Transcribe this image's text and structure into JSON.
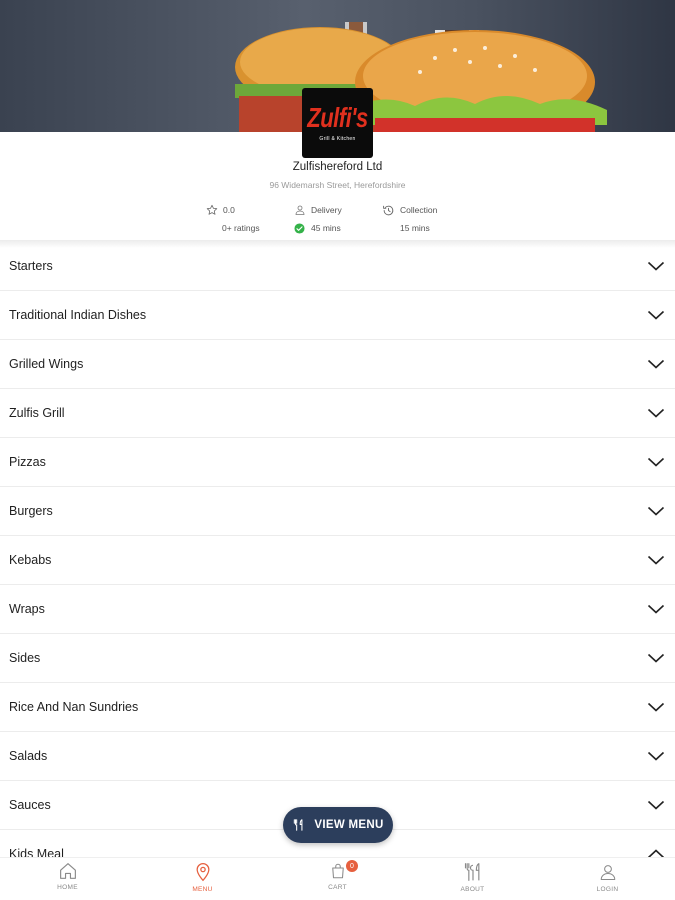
{
  "store": {
    "logo_text": "Zulfi's",
    "logo_subtext": "Grill & Kitchen",
    "name": "Zulfishereford Ltd",
    "address": "96 Widemarsh Street, Herefordshire"
  },
  "stats": {
    "rating_value": "0.0",
    "rating_count": "0+ ratings",
    "delivery_label": "Delivery",
    "delivery_time": "45 mins",
    "collection_label": "Collection",
    "collection_time": "15 mins"
  },
  "menu": {
    "categories": [
      {
        "label": "Starters",
        "expanded": false
      },
      {
        "label": "Traditional Indian Dishes",
        "expanded": false
      },
      {
        "label": "Grilled Wings",
        "expanded": false
      },
      {
        "label": "Zulfis Grill",
        "expanded": false
      },
      {
        "label": "Pizzas",
        "expanded": false
      },
      {
        "label": "Burgers",
        "expanded": false
      },
      {
        "label": "Kebabs",
        "expanded": false
      },
      {
        "label": "Wraps",
        "expanded": false
      },
      {
        "label": "Sides",
        "expanded": false
      },
      {
        "label": "Rice And Nan Sundries",
        "expanded": false
      },
      {
        "label": "Salads",
        "expanded": false
      },
      {
        "label": "Sauces",
        "expanded": false
      },
      {
        "label": "Kids Meal",
        "expanded": true
      }
    ]
  },
  "view_menu_button": {
    "label": "VIEW MENU"
  },
  "bottom_nav": {
    "home": "HOME",
    "menu": "MENU",
    "cart": "CART",
    "cart_count": "0",
    "about": "ABOUT",
    "login": "LOGIN"
  },
  "colors": {
    "accent": "#e6603f",
    "button": "#2c3e5c",
    "success": "#34b249"
  }
}
